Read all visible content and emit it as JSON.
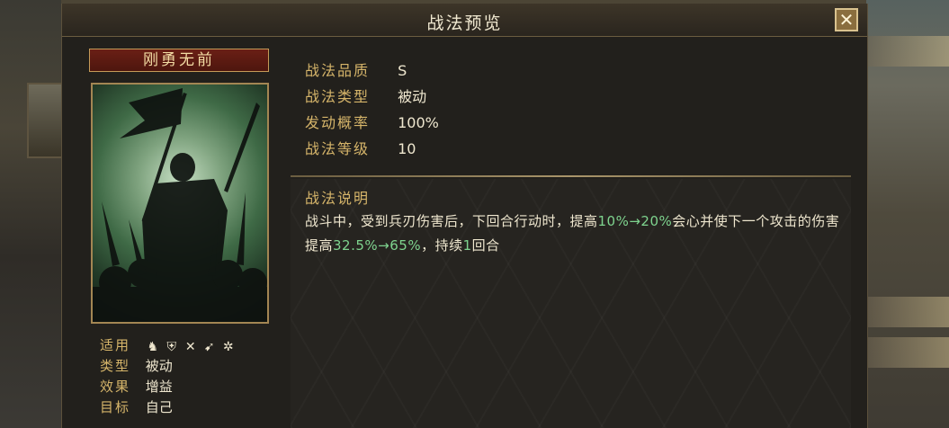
{
  "window": {
    "title": "战法预览",
    "close_glyph": "✕"
  },
  "skill": {
    "name": "刚勇无前",
    "portrait_icon": "warrior-with-banner-illustration"
  },
  "attributes": [
    {
      "label": "适用",
      "icons": [
        "cavalry-icon",
        "shield-icon",
        "bow-icon",
        "spear-icon",
        "wheel-icon"
      ]
    },
    {
      "label": "类型",
      "value": "被动"
    },
    {
      "label": "效果",
      "value": "增益"
    },
    {
      "label": "目标",
      "value": "自己"
    }
  ],
  "stats": [
    {
      "label": "战法品质",
      "value": "S"
    },
    {
      "label": "战法类型",
      "value": "被动"
    },
    {
      "label": "发动概率",
      "value": "100%"
    },
    {
      "label": "战法等级",
      "value": "10"
    }
  ],
  "description": {
    "title": "战法说明",
    "segments": [
      {
        "text": "战斗中，受到兵刃伤害后，下回合行动时，提高",
        "highlight": false
      },
      {
        "text": "10%→20%",
        "highlight": true
      },
      {
        "text": "会心并使下一个攻击的伤害提高",
        "highlight": false
      },
      {
        "text": "32.5%→65%",
        "highlight": true
      },
      {
        "text": "，持续",
        "highlight": false
      },
      {
        "text": "1",
        "highlight": true
      },
      {
        "text": "回合",
        "highlight": false
      }
    ]
  },
  "colors": {
    "accent": "#d6b56a",
    "highlight": "#7ed38e",
    "text": "#efe7cf"
  }
}
